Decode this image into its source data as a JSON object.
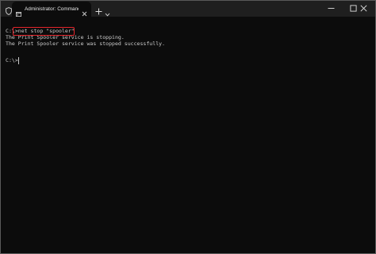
{
  "window": {
    "tab_title": "Administrator: Command Prompt",
    "icons": {
      "shield": "shield-icon",
      "tab": "terminal-icon",
      "tab_close": "close-icon",
      "new_tab": "plus-icon",
      "dropdown": "chevron-down-icon",
      "minimize": "minimize-icon",
      "maximize": "maximize-icon",
      "close": "close-icon"
    }
  },
  "terminal": {
    "lines": [
      "C:\\>net stop \"spooler\"",
      "The Print Spooler service is stopping.",
      "The Print Spooler service was stopped successfully.",
      "",
      "C:\\>"
    ]
  },
  "colors": {
    "background": "#0c0c0c",
    "titlebar": "#1f1f1f",
    "text": "#cccccc",
    "highlight": "#e3242b"
  }
}
